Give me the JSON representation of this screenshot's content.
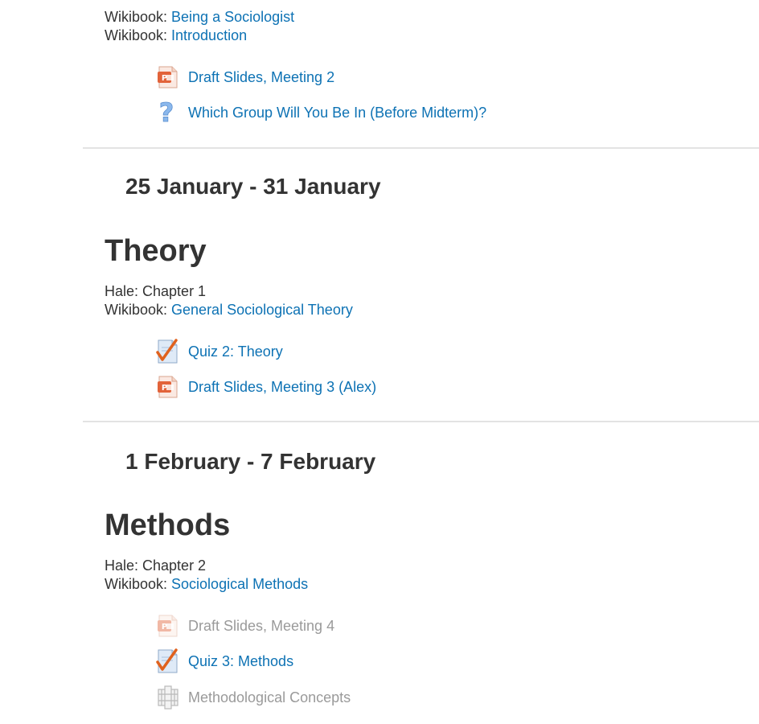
{
  "intro_section": {
    "lines": [
      {
        "prefix": "Wikibook: ",
        "link": "Being a Sociologist"
      },
      {
        "prefix": "Wikibook: ",
        "link": "Introduction"
      }
    ],
    "activities": [
      {
        "icon": "powerpoint-icon",
        "label": "Draft Slides, Meeting 2",
        "dimmed": false
      },
      {
        "icon": "question-icon",
        "label": "Which Group Will You Be In (Before Midterm)?",
        "dimmed": false
      }
    ]
  },
  "week2": {
    "date_range": "25 January - 31 January",
    "title": "Theory",
    "line1": "Hale: Chapter 1",
    "line2_prefix": "Wikibook: ",
    "line2_link": "General Sociological Theory",
    "activities": [
      {
        "icon": "quiz-icon",
        "label": "Quiz 2: Theory",
        "dimmed": false
      },
      {
        "icon": "powerpoint-icon",
        "label": "Draft Slides, Meeting 3 (Alex)",
        "dimmed": false
      }
    ]
  },
  "week3": {
    "date_range": "1 February - 7 February",
    "title": "Methods",
    "line1": "Hale: Chapter 2",
    "line2_prefix": "Wikibook: ",
    "line2_link": "Sociological Methods",
    "activities": [
      {
        "icon": "powerpoint-icon",
        "label": "Draft Slides, Meeting 4",
        "dimmed": true
      },
      {
        "icon": "quiz-icon",
        "label": "Quiz 3: Methods",
        "dimmed": false
      },
      {
        "icon": "glossary-icon",
        "label": "Methodological Concepts",
        "dimmed": true
      }
    ]
  },
  "colors": {
    "link": "#0d72b4",
    "text": "#333333",
    "dimmed": "#9a9a9a",
    "divider": "#e3e3e3"
  }
}
